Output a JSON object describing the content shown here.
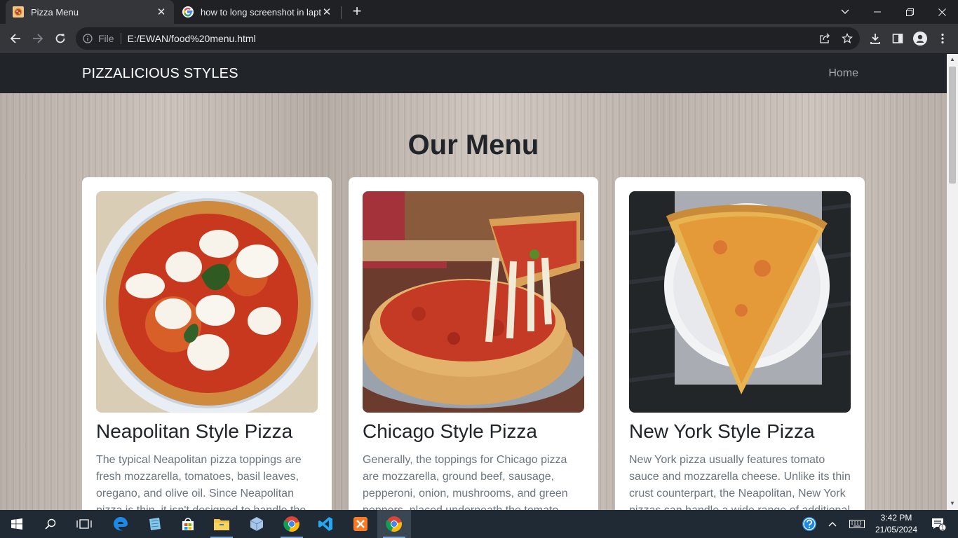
{
  "browser": {
    "tabs": [
      {
        "title": "Pizza Menu",
        "active": true,
        "favicon": "pizza-favicon-icon"
      },
      {
        "title": "how to long screenshot in laptop",
        "active": false,
        "favicon": "google-favicon-icon"
      }
    ],
    "address": {
      "scheme_label": "File",
      "url": "E:/EWAN/food%20menu.html"
    }
  },
  "page": {
    "brand": "PIZZALICIOUS STYLES",
    "nav": [
      {
        "label": "Home"
      }
    ],
    "heading": "Our Menu",
    "cards": [
      {
        "title": "Neapolitan Style Pizza",
        "description": "The typical Neapolitan pizza toppings are fresh mozzarella, tomatoes, basil leaves, oregano, and olive oil. Since Neapolitan pizza is thin, it isn't designed to handle the",
        "image": "neapolitan-pizza-photo"
      },
      {
        "title": "Chicago Style Pizza",
        "description": "Generally, the toppings for Chicago pizza are mozzarella, ground beef, sausage, pepperoni, onion, mushrooms, and green peppers, placed underneath the tomato",
        "image": "chicago-pizza-photo"
      },
      {
        "title": "New York Style Pizza",
        "description": "New York pizza usually features tomato sauce and mozzarella cheese. Unlike its thin crust counterpart, the Neapolitan, New York pizzas can handle a wide range of additional",
        "image": "new-york-pizza-photo"
      }
    ],
    "colors": {
      "navbar": "#212529",
      "heading": "#212529",
      "body_text": "#6c757d",
      "card": "#ffffff"
    }
  },
  "taskbar": {
    "apps": [
      "start",
      "search",
      "task-view",
      "edge",
      "notepad",
      "store",
      "file-explorer",
      "3d-viewer",
      "chrome",
      "vscode",
      "xampp",
      "chrome-active"
    ],
    "clock": {
      "time": "3:42 PM",
      "date": "21/05/2024"
    },
    "notification_count": "1"
  }
}
